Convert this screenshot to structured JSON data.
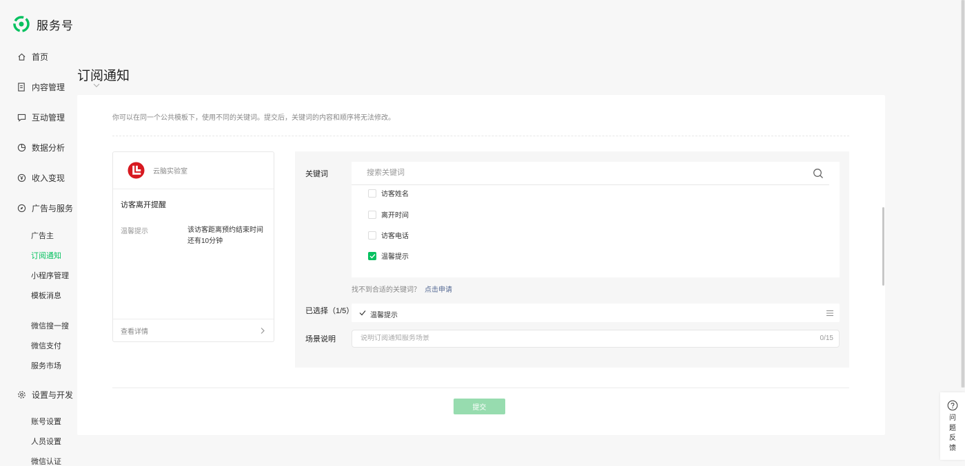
{
  "brand": {
    "title": "服务号"
  },
  "nav": {
    "items": [
      {
        "label": "首页",
        "icon": "home-icon"
      },
      {
        "label": "内容管理",
        "icon": "document-icon"
      },
      {
        "label": "互动管理",
        "icon": "chat-icon"
      },
      {
        "label": "数据分析",
        "icon": "pie-chart-icon"
      },
      {
        "label": "收入变现",
        "icon": "yuan-icon"
      },
      {
        "label": "广告与服务",
        "icon": "compass-icon"
      }
    ],
    "ads_sub": [
      "广告主",
      "订阅通知",
      "小程序管理",
      "模板消息"
    ],
    "wechat_sub": [
      "微信搜一搜",
      "微信支付",
      "服务市场"
    ],
    "settings": {
      "label": "设置与开发",
      "icon": "gear-icon"
    },
    "settings_sub": [
      "账号设置",
      "人员设置",
      "微信认证"
    ],
    "active": "订阅通知",
    "accent": "#07c160"
  },
  "page": {
    "title": "订阅通知"
  },
  "intro": "你可以在同一个公共模板下，使用不同的关键词。提交后，关键词的内容和顺序将无法修改。",
  "preview": {
    "account": "云脑实验室",
    "title": "访客离开提醒",
    "field_label": "温馨提示",
    "field_value": "该访客距离预约结束时间还有10分钟",
    "footer_link": "查看详情"
  },
  "config": {
    "keyword_label": "关键词",
    "search_placeholder": "搜索关键词",
    "keywords": [
      {
        "label": "访客姓名",
        "checked": false
      },
      {
        "label": "离开时间",
        "checked": false
      },
      {
        "label": "访客电话",
        "checked": false
      },
      {
        "label": "温馨提示",
        "checked": true
      }
    ],
    "help_text": "找不到合适的关键词？",
    "help_link": "点击申请",
    "selected_label": "已选择（1/5）",
    "selected_item": "温馨提示",
    "scene_label": "场景说明",
    "scene_placeholder": "说明订阅通知服务场景",
    "scene_count": "0/15"
  },
  "submit": {
    "label": "提交",
    "color": "#97dcaf"
  },
  "feedback": {
    "label": "问题反馈"
  }
}
